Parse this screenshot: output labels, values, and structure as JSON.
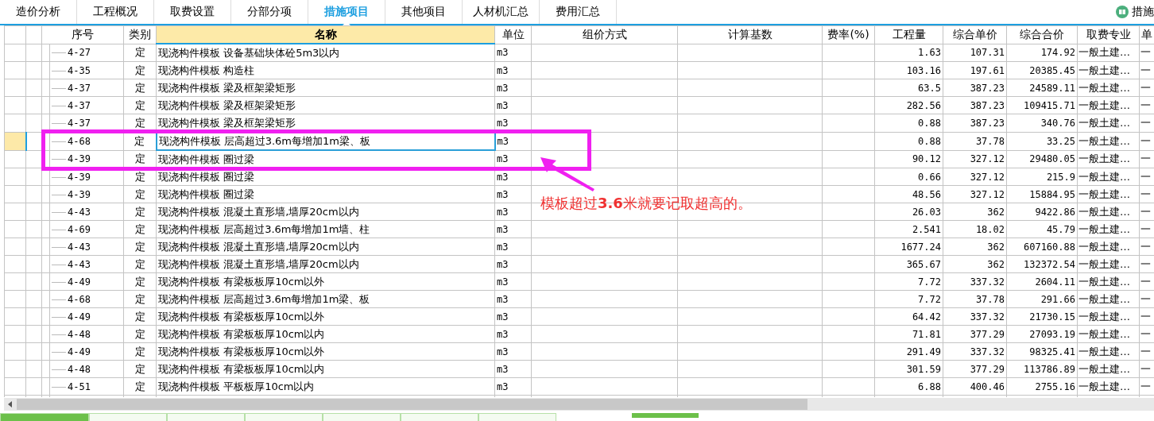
{
  "tabs": [
    {
      "label": "造价分析",
      "selected": false
    },
    {
      "label": "工程概况",
      "selected": false
    },
    {
      "label": "取费设置",
      "selected": false
    },
    {
      "label": "分部分项",
      "selected": false
    },
    {
      "label": "措施项目",
      "selected": true
    },
    {
      "label": "其他项目",
      "selected": false
    },
    {
      "label": "人材机汇总",
      "selected": false
    },
    {
      "label": "费用汇总",
      "selected": false
    }
  ],
  "right_label": "措施",
  "table": {
    "columns": [
      "序号",
      "类别",
      "名称",
      "单位",
      "组价方式",
      "计算基数",
      "费率(%)",
      "工程量",
      "综合单价",
      "综合合价",
      "取费专业",
      "单"
    ],
    "rows": [
      {
        "seq": "4-27",
        "type": "定",
        "name": "现浇构件模板 设备基础块体砼5m3以内",
        "unit": "m3",
        "qty": "1.63",
        "unit_price": "107.31",
        "total": "174.92",
        "fee_type": "一般土建…",
        "column_12": "一",
        "selected": false
      },
      {
        "seq": "4-35",
        "type": "定",
        "name": "现浇构件模板 构造柱",
        "unit": "m3",
        "qty": "103.16",
        "unit_price": "197.61",
        "total": "20385.45",
        "fee_type": "一般土建…",
        "column_12": "一",
        "selected": false
      },
      {
        "seq": "4-37",
        "type": "定",
        "name": "现浇构件模板 梁及框架梁矩形",
        "unit": "m3",
        "qty": "63.5",
        "unit_price": "387.23",
        "total": "24589.11",
        "fee_type": "一般土建…",
        "column_12": "一",
        "selected": false
      },
      {
        "seq": "4-37",
        "type": "定",
        "name": "现浇构件模板 梁及框架梁矩形",
        "unit": "m3",
        "qty": "282.56",
        "unit_price": "387.23",
        "total": "109415.71",
        "fee_type": "一般土建…",
        "column_12": "一",
        "selected": false
      },
      {
        "seq": "4-37",
        "type": "定",
        "name": "现浇构件模板 梁及框架梁矩形",
        "unit": "m3",
        "qty": "0.88",
        "unit_price": "387.23",
        "total": "340.76",
        "fee_type": "一般土建…",
        "column_12": "一",
        "selected": false
      },
      {
        "seq": "4-68",
        "type": "定",
        "name": "现浇构件模板 层高超过3.6m每增加1m梁、板",
        "unit": "m3",
        "qty": "0.88",
        "unit_price": "37.78",
        "total": "33.25",
        "fee_type": "一般土建…",
        "column_12": "一",
        "selected": true
      },
      {
        "seq": "4-39",
        "type": "定",
        "name": "现浇构件模板 圈过梁",
        "unit": "m3",
        "qty": "90.12",
        "unit_price": "327.12",
        "total": "29480.05",
        "fee_type": "一般土建…",
        "column_12": "一",
        "selected": false
      },
      {
        "seq": "4-39",
        "type": "定",
        "name": "现浇构件模板 圈过梁",
        "unit": "m3",
        "qty": "0.66",
        "unit_price": "327.12",
        "total": "215.9",
        "fee_type": "一般土建…",
        "column_12": "一",
        "selected": false
      },
      {
        "seq": "4-39",
        "type": "定",
        "name": "现浇构件模板 圈过梁",
        "unit": "m3",
        "qty": "48.56",
        "unit_price": "327.12",
        "total": "15884.95",
        "fee_type": "一般土建…",
        "column_12": "一",
        "selected": false
      },
      {
        "seq": "4-43",
        "type": "定",
        "name": "现浇构件模板 混凝土直形墙,墙厚20cm以内",
        "unit": "m3",
        "qty": "26.03",
        "unit_price": "362",
        "total": "9422.86",
        "fee_type": "一般土建…",
        "column_12": "一",
        "selected": false
      },
      {
        "seq": "4-69",
        "type": "定",
        "name": "现浇构件模板 层高超过3.6m每增加1m墙、柱",
        "unit": "m3",
        "qty": "2.541",
        "unit_price": "18.02",
        "total": "45.79",
        "fee_type": "一般土建…",
        "column_12": "一",
        "selected": false
      },
      {
        "seq": "4-43",
        "type": "定",
        "name": "现浇构件模板 混凝土直形墙,墙厚20cm以内",
        "unit": "m3",
        "qty": "1677.24",
        "unit_price": "362",
        "total": "607160.88",
        "fee_type": "一般土建…",
        "column_12": "一",
        "selected": false
      },
      {
        "seq": "4-43",
        "type": "定",
        "name": "现浇构件模板 混凝土直形墙,墙厚20cm以内",
        "unit": "m3",
        "qty": "365.67",
        "unit_price": "362",
        "total": "132372.54",
        "fee_type": "一般土建…",
        "column_12": "一",
        "selected": false
      },
      {
        "seq": "4-49",
        "type": "定",
        "name": "现浇构件模板 有梁板板厚10cm以外",
        "unit": "m3",
        "qty": "7.72",
        "unit_price": "337.32",
        "total": "2604.11",
        "fee_type": "一般土建…",
        "column_12": "一",
        "selected": false
      },
      {
        "seq": "4-68",
        "type": "定",
        "name": "现浇构件模板 层高超过3.6m每增加1m梁、板",
        "unit": "m3",
        "qty": "7.72",
        "unit_price": "37.78",
        "total": "291.66",
        "fee_type": "一般土建…",
        "column_12": "一",
        "selected": false
      },
      {
        "seq": "4-49",
        "type": "定",
        "name": "现浇构件模板 有梁板板厚10cm以外",
        "unit": "m3",
        "qty": "64.42",
        "unit_price": "337.32",
        "total": "21730.15",
        "fee_type": "一般土建…",
        "column_12": "一",
        "selected": false
      },
      {
        "seq": "4-48",
        "type": "定",
        "name": "现浇构件模板 有梁板板厚10cm以内",
        "unit": "m3",
        "qty": "71.81",
        "unit_price": "377.29",
        "total": "27093.19",
        "fee_type": "一般土建…",
        "column_12": "一",
        "selected": false
      },
      {
        "seq": "4-49",
        "type": "定",
        "name": "现浇构件模板 有梁板板厚10cm以外",
        "unit": "m3",
        "qty": "291.49",
        "unit_price": "337.32",
        "total": "98325.41",
        "fee_type": "一般土建…",
        "column_12": "一",
        "selected": false
      },
      {
        "seq": "4-48",
        "type": "定",
        "name": "现浇构件模板 有梁板板厚10cm以内",
        "unit": "m3",
        "qty": "301.59",
        "unit_price": "377.29",
        "total": "113786.89",
        "fee_type": "一般土建…",
        "column_12": "一",
        "selected": false
      },
      {
        "seq": "4-51",
        "type": "定",
        "name": "现浇构件模板 平板板厚10cm以内",
        "unit": "m3",
        "qty": "6.88",
        "unit_price": "400.46",
        "total": "2755.16",
        "fee_type": "一般土建…",
        "column_12": "一",
        "selected": false
      }
    ]
  },
  "annotation": {
    "text": "模板超过**3.6**米就要记取超高的。"
  },
  "bottom_tabs": [
    {
      "selected": true
    },
    {
      "selected": false
    },
    {
      "selected": false
    },
    {
      "selected": false
    },
    {
      "selected": false
    },
    {
      "selected": false
    },
    {
      "selected": false
    }
  ]
}
